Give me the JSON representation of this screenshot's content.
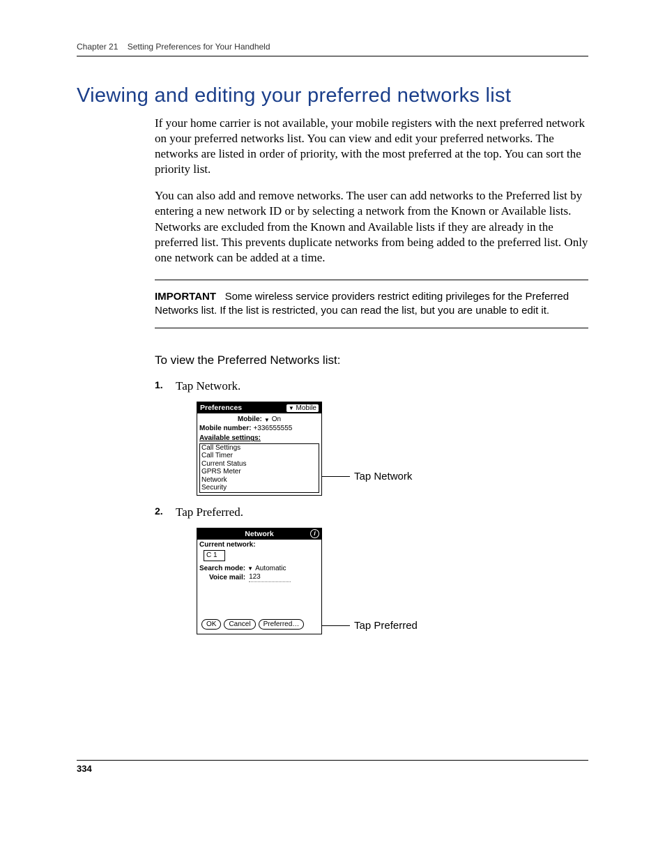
{
  "header": {
    "chapter": "Chapter 21",
    "title": "Setting Preferences for Your Handheld"
  },
  "section_heading": "Viewing and editing your preferred networks list",
  "para1": "If your home carrier is not available, your mobile registers with the next preferred network on your preferred networks list. You can view and edit your preferred networks. The networks are listed in order of priority, with the most preferred at the top. You can sort the priority list.",
  "para2": "You can also add and remove networks. The user can add networks to the Preferred list by entering a new network ID or by selecting a network from the Known or Available lists. Networks are excluded from the Known and Available lists if they are already in the preferred list. This prevents duplicate networks from being added to the preferred list. Only one network can be added at a time.",
  "important": {
    "label": "IMPORTANT",
    "text": "Some wireless service providers restrict editing privileges for the Preferred Networks list. If the list is restricted, you can read the list, but you are unable to edit it."
  },
  "procedure_title": "To view the Preferred Networks list:",
  "steps": {
    "s1": "Tap Network.",
    "s2": "Tap Preferred."
  },
  "screen1": {
    "title": "Preferences",
    "title_drop": "Mobile",
    "mobile_label": "Mobile:",
    "mobile_value": "On",
    "number_label": "Mobile number:",
    "number_value": "+336555555",
    "avail_label": "Available settings:",
    "items": {
      "i0": "Call Settings",
      "i1": "Call Timer",
      "i2": "Current Status",
      "i3": "GPRS Meter",
      "i4": "Network",
      "i5": "Security"
    },
    "callout": "Tap Network"
  },
  "screen2": {
    "title": "Network",
    "current_label": "Current network:",
    "current_value": "C 1",
    "search_label": "Search mode:",
    "search_value": "Automatic",
    "vm_label": "Voice mail:",
    "vm_value": "123",
    "btn_ok": "OK",
    "btn_cancel": "Cancel",
    "btn_pref": "Preferred…",
    "callout": "Tap Preferred"
  },
  "page_number": "334"
}
